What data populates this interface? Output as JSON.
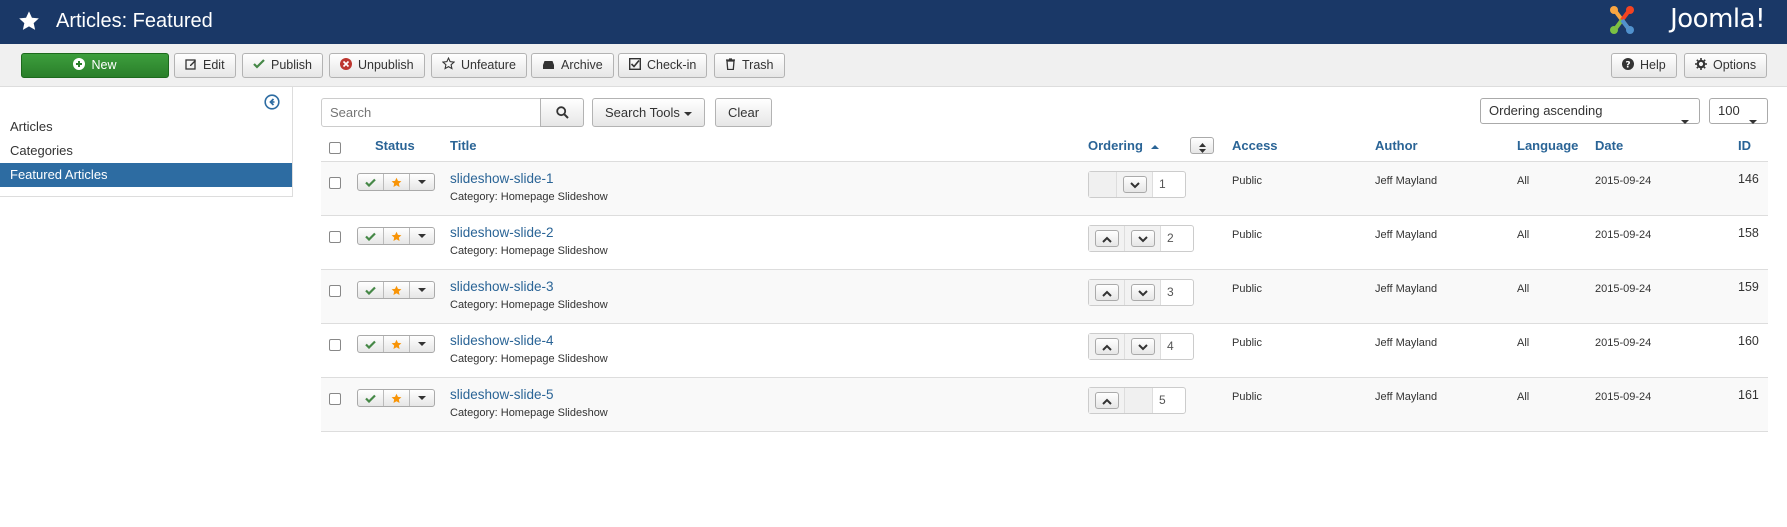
{
  "header": {
    "title": "Articles: Featured",
    "logo_text": "Joomla!"
  },
  "toolbar": {
    "new_label": "New",
    "edit_label": "Edit",
    "publish_label": "Publish",
    "unpublish_label": "Unpublish",
    "unfeature_label": "Unfeature",
    "archive_label": "Archive",
    "checkin_label": "Check-in",
    "trash_label": "Trash",
    "help_label": "Help",
    "options_label": "Options"
  },
  "sidebar": {
    "items": [
      {
        "label": "Articles",
        "active": false
      },
      {
        "label": "Categories",
        "active": false
      },
      {
        "label": "Featured Articles",
        "active": true
      }
    ]
  },
  "filters": {
    "search_placeholder": "Search",
    "search_tools_label": "Search Tools",
    "clear_label": "Clear",
    "ordering_selected": "Ordering ascending",
    "limit_selected": "100"
  },
  "table": {
    "columns": {
      "status": "Status",
      "title": "Title",
      "ordering": "Ordering",
      "access": "Access",
      "author": "Author",
      "language": "Language",
      "date": "Date",
      "id": "ID"
    },
    "rows": [
      {
        "title": "slideshow-slide-1",
        "category": "Category: Homepage Slideshow",
        "ordering": "1",
        "access": "Public",
        "author": "Jeff Mayland",
        "language": "All",
        "date": "2015-09-24",
        "id": "146",
        "has_up": false,
        "has_down": true
      },
      {
        "title": "slideshow-slide-2",
        "category": "Category: Homepage Slideshow",
        "ordering": "2",
        "access": "Public",
        "author": "Jeff Mayland",
        "language": "All",
        "date": "2015-09-24",
        "id": "158",
        "has_up": true,
        "has_down": true
      },
      {
        "title": "slideshow-slide-3",
        "category": "Category: Homepage Slideshow",
        "ordering": "3",
        "access": "Public",
        "author": "Jeff Mayland",
        "language": "All",
        "date": "2015-09-24",
        "id": "159",
        "has_up": true,
        "has_down": true
      },
      {
        "title": "slideshow-slide-4",
        "category": "Category: Homepage Slideshow",
        "ordering": "4",
        "access": "Public",
        "author": "Jeff Mayland",
        "language": "All",
        "date": "2015-09-24",
        "id": "160",
        "has_up": true,
        "has_down": true
      },
      {
        "title": "slideshow-slide-5",
        "category": "Category: Homepage Slideshow",
        "ordering": "5",
        "access": "Public",
        "author": "Jeff Mayland",
        "language": "All",
        "date": "2015-09-24",
        "id": "161",
        "has_up": true,
        "has_down": false
      }
    ]
  },
  "colors": {
    "header_bg": "#1a3867",
    "link": "#2a6496",
    "new_button": "#2f8a2f",
    "sidebar_active": "#2d6ca2",
    "publish_check": "#468847",
    "featured_star": "#f89406"
  }
}
